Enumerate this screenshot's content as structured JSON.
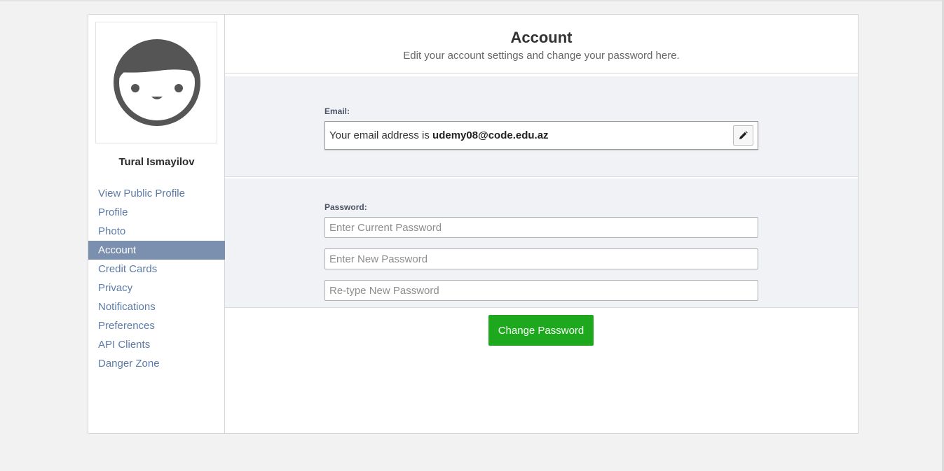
{
  "user": {
    "name": "Tural Ismayilov"
  },
  "nav": {
    "items": [
      {
        "label": "View Public Profile"
      },
      {
        "label": "Profile"
      },
      {
        "label": "Photo"
      },
      {
        "label": "Account",
        "active": true
      },
      {
        "label": "Credit Cards"
      },
      {
        "label": "Privacy"
      },
      {
        "label": "Notifications"
      },
      {
        "label": "Preferences"
      },
      {
        "label": "API Clients"
      },
      {
        "label": "Danger Zone"
      }
    ]
  },
  "header": {
    "title": "Account",
    "subtitle": "Edit your account settings and change your password here."
  },
  "email": {
    "label": "Email:",
    "prefix": "Your email address is ",
    "address": "udemy08@code.edu.az",
    "edit_icon": "pencil-icon"
  },
  "password": {
    "label": "Password:",
    "current_placeholder": "Enter Current Password",
    "new_placeholder": "Enter New Password",
    "retype_placeholder": "Re-type New Password",
    "submit_label": "Change Password"
  },
  "colors": {
    "accent_active_nav": "#7b8faf",
    "link": "#5b7ba6",
    "button_green": "#1ea81e",
    "section_bg": "#f1f2f5"
  }
}
